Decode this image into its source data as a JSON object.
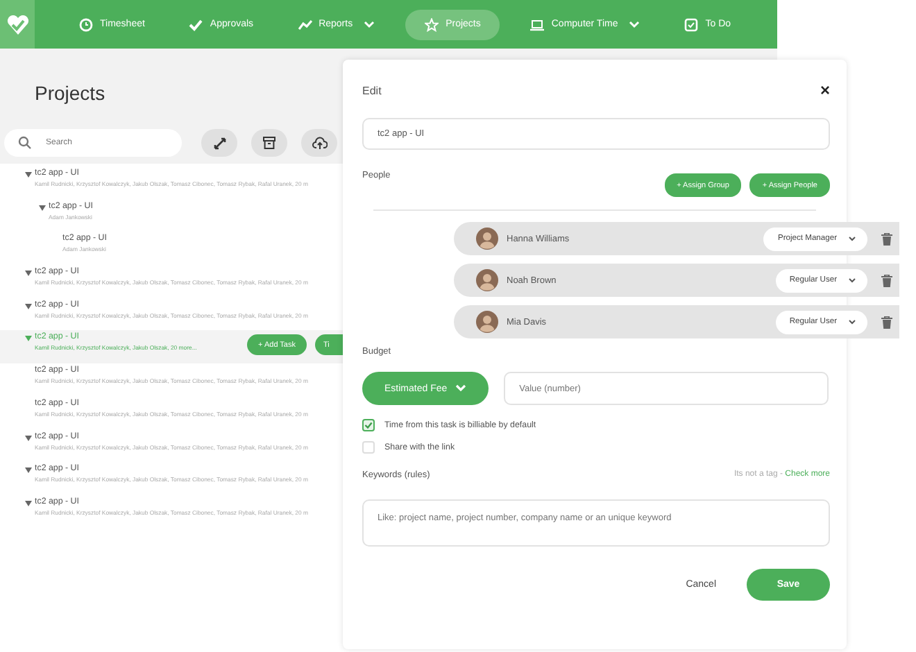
{
  "nav": {
    "items": [
      {
        "label": "Timesheet",
        "dropdown": false,
        "selected": false
      },
      {
        "label": "Approvals",
        "dropdown": false,
        "selected": false
      },
      {
        "label": "Reports",
        "dropdown": true,
        "selected": false
      },
      {
        "label": "Projects",
        "dropdown": false,
        "selected": true
      },
      {
        "label": "Computer Time",
        "dropdown": true,
        "selected": false
      },
      {
        "label": "To Do",
        "dropdown": false,
        "selected": false
      }
    ]
  },
  "projects": {
    "title": "Projects",
    "search": {
      "placeholder": "Search"
    },
    "tree": [
      {
        "name": "tc2 app - UI",
        "people": "Kamil Rudnicki, Krzysztof Kowalczyk, Jakub Olszak, Tomasz Cibonec, Tomasz Rybak, Rafal Uranek, 20 m",
        "expanded": true,
        "selected": false,
        "children": [
          {
            "name": "tc2 app - UI",
            "people": "Adam Jankowski",
            "expanded": true,
            "selected": false,
            "children": [
              {
                "name": "tc2 app - UI",
                "people": "Adam Jankowski",
                "expanded": false,
                "selected": false
              }
            ]
          }
        ]
      },
      {
        "name": "tc2 app - UI",
        "people": "Kamil Rudnicki, Krzysztof Kowalczyk, Jakub Olszak, Tomasz Cibonec, Tomasz Rybak, Rafal Uranek, 20 m",
        "expanded": true,
        "selected": false
      },
      {
        "name": "tc2 app - UI",
        "people": "Kamil Rudnicki, Krzysztof Kowalczyk, Jakub Olszak, Tomasz Cibonec, Tomasz Rybak, Rafal Uranek, 20 m",
        "expanded": true,
        "selected": false
      },
      {
        "name": "tc2 app - UI",
        "people": "Kamil Rudnicki, Krzysztof Kowalczyk, Jakub Olszak, 20 more...",
        "expanded": true,
        "selected": true,
        "actions": [
          "+ Add Task",
          "Ti"
        ]
      },
      {
        "name": "tc2 app - UI",
        "people": "Kamil Rudnicki, Krzysztof Kowalczyk, Jakub Olszak, Tomasz Cibonec, Tomasz Rybak, Rafal Uranek, 20 m",
        "expanded": false,
        "selected": false
      },
      {
        "name": "tc2 app - UI",
        "people": "Kamil Rudnicki, Krzysztof Kowalczyk, Jakub Olszak, Tomasz Cibonec, Tomasz Rybak, Rafal Uranek, 20 m",
        "expanded": false,
        "selected": false
      },
      {
        "name": "tc2 app - UI",
        "people": "Kamil Rudnicki, Krzysztof Kowalczyk, Jakub Olszak, Tomasz Cibonec, Tomasz Rybak, Rafal Uranek, 20 m",
        "expanded": true,
        "selected": false
      },
      {
        "name": "tc2 app - UI",
        "people": "Kamil Rudnicki, Krzysztof Kowalczyk, Jakub Olszak, Tomasz Cibonec, Tomasz Rybak, Rafal Uranek, 20 m",
        "expanded": true,
        "selected": false
      },
      {
        "name": "tc2 app - UI",
        "people": "Kamil Rudnicki, Krzysztof Kowalczyk, Jakub Olszak, Tomasz Cibonec, Tomasz Rybak, Rafal Uranek, 20 m",
        "expanded": true,
        "selected": false
      }
    ]
  },
  "dialog": {
    "title": "Edit",
    "close": "×",
    "name_value": "tc2 app - UI",
    "people_label": "People",
    "assign_buttons": [
      "+ Assign Group",
      "+ Assign People"
    ],
    "people": [
      {
        "name": "Hanna Williams",
        "role": "Project Manager"
      },
      {
        "name": "Noah Brown",
        "role": "Regular User"
      },
      {
        "name": "Mia Davis",
        "role": "Regular User"
      }
    ],
    "budget_label": "Budget",
    "budget_type": "Estimated Fee",
    "budget_placeholder": "Value (number)",
    "options": [
      {
        "label": "Time from this task is billiable by default",
        "checked": true
      },
      {
        "label": "Share with the link",
        "checked": false
      }
    ],
    "keywords_label": "Keywords (rules)",
    "keywords_note": "Its not a tag - ",
    "keywords_link": "Check more",
    "keywords_placeholder": "Like: project name, project number, company name or an unique keyword",
    "cancel": "Cancel",
    "save": "Save"
  }
}
